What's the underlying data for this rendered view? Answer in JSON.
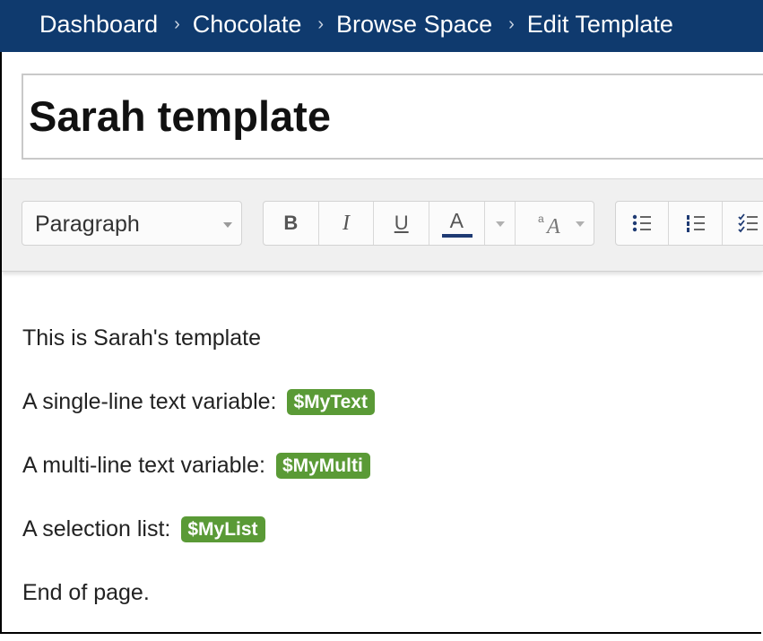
{
  "breadcrumb": [
    "Dashboard",
    "Chocolate",
    "Browse Space",
    "Edit Template"
  ],
  "page": {
    "title": "Sarah template"
  },
  "toolbar": {
    "paragraph_style": "Paragraph",
    "bold": "B",
    "italic": "I",
    "underline": "U",
    "text_color": "A",
    "text_color_accent": "#1e3a73",
    "format_icon": "aA",
    "list_icons": [
      "bullet-list-icon",
      "numbered-list-icon",
      "task-list-icon"
    ]
  },
  "content": {
    "intro": "This is Sarah's template",
    "line1_label": "A single-line text variable:",
    "line1_var": "$MyText",
    "line2_label": "A multi-line text variable:",
    "line2_var": "$MyMulti",
    "line3_label": "A selection list:",
    "line3_var": "$MyList",
    "end": "End of page."
  },
  "colors": {
    "header_bg": "#0f3a6e",
    "variable_bg": "#5a9a36"
  }
}
